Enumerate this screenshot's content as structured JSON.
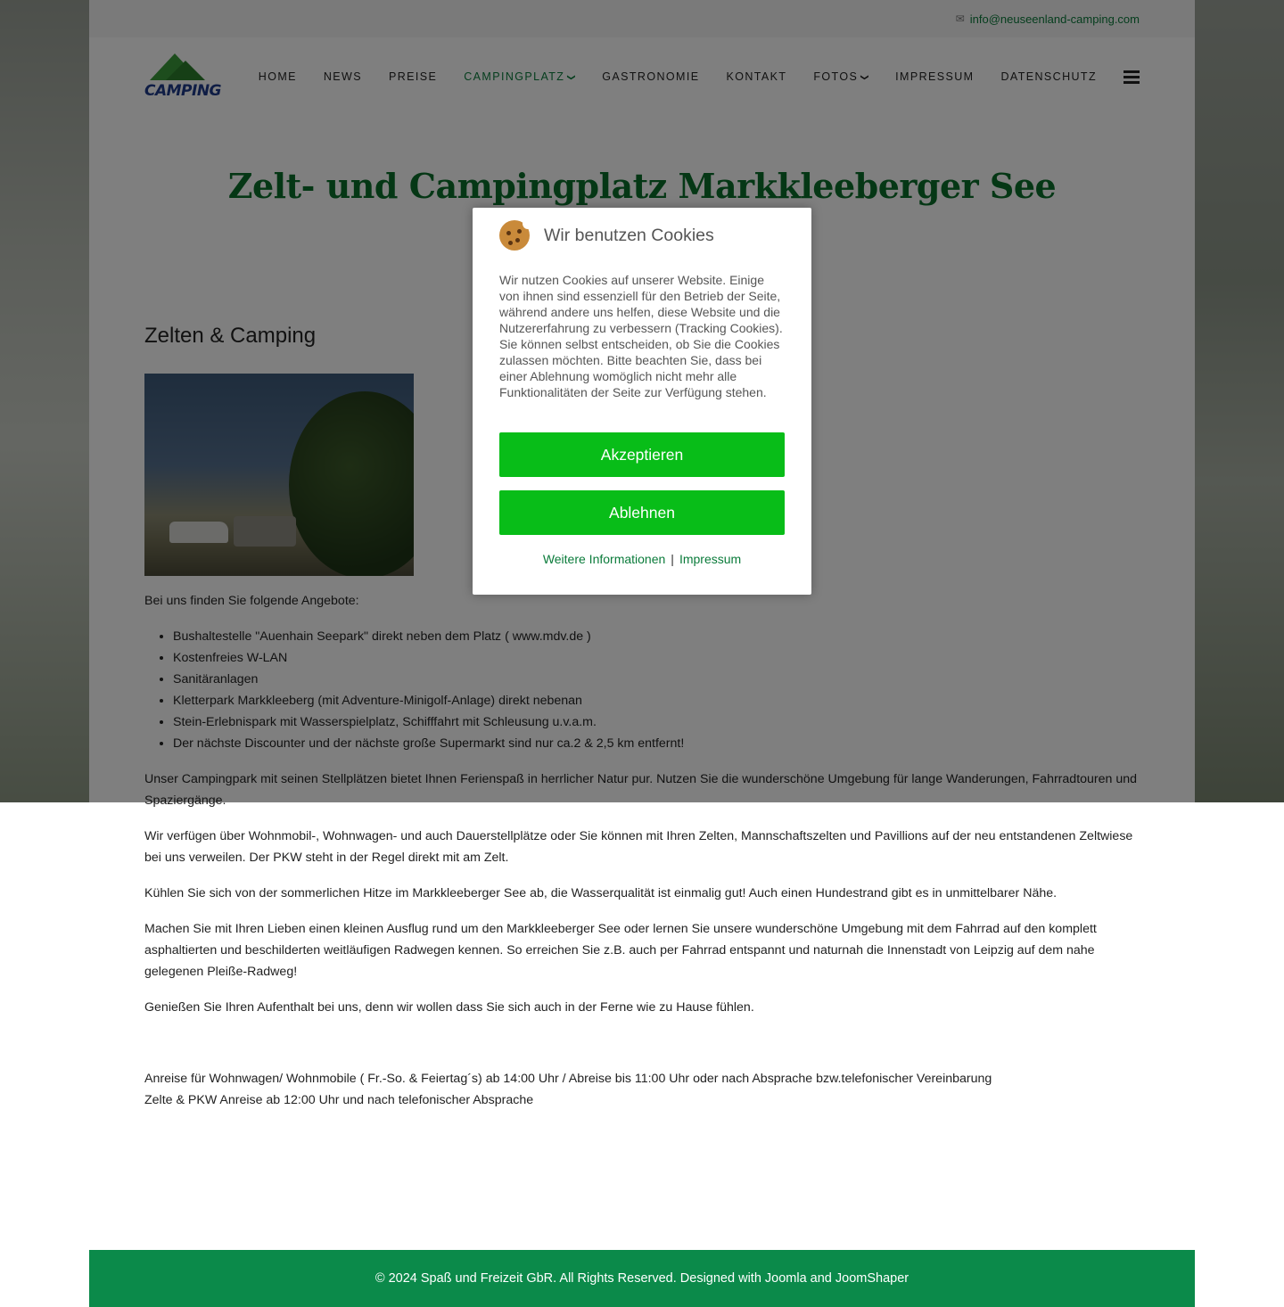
{
  "topbar": {
    "email": "info@neuseenland-camping.com",
    "email_icon": "envelope-icon"
  },
  "logo": {
    "word": "CAMPING"
  },
  "nav": {
    "items": [
      {
        "label": "HOME"
      },
      {
        "label": "NEWS"
      },
      {
        "label": "PREISE"
      },
      {
        "label": "CAMPINGPLATZ",
        "active": true,
        "has_dropdown": true
      },
      {
        "label": "GASTRONOMIE"
      },
      {
        "label": "KONTAKT"
      },
      {
        "label": "FOTOS",
        "has_dropdown": true
      },
      {
        "label": "IMPRESSUM"
      },
      {
        "label": "DATENSCHUTZ"
      }
    ],
    "caret": "❯"
  },
  "main": {
    "title": "Zelt- und Campingplatz Markkleeberger See",
    "section_heading": "Zelten & Camping",
    "intro": "Bei uns finden Sie folgende Angebote:",
    "offers": [
      "Bushaltestelle \"Auenhain Seepark\" direkt neben dem Platz ( www.mdv.de )",
      "Kostenfreies W-LAN",
      "Sanitäranlagen",
      "Kletterpark Markkleeberg (mit Adventure-Minigolf-Anlage) direkt nebenan",
      "Stein-Erlebnispark mit Wasserspielplatz, Schifffahrt mit Schleusung u.v.a.m.",
      "Der nächste Discounter und der nächste große Supermarkt sind nur ca.2 & 2,5 km entfernt!"
    ],
    "paragraphs": [
      "Unser Campingpark mit seinen Stellplätzen bietet Ihnen Ferienspaß in herrlicher Natur pur. Nutzen Sie die wunderschöne Umgebung für lange Wanderungen, Fahrradtouren und Spaziergänge.",
      "Wir verfügen über Wohnmobil-, Wohnwagen- und auch Dauerstellplätze oder Sie können mit Ihren Zelten, Mannschaftszelten und Pavillions auf der neu entstandenen Zeltwiese bei uns verweilen. Der PKW steht in der Regel direkt mit am Zelt.",
      "Kühlen Sie sich von der sommerlichen Hitze im Markkleeberger See ab, die Wasserqualität ist einmalig gut! Auch einen Hundestrand gibt es in unmittelbarer Nähe.",
      "Machen Sie mit Ihren Lieben einen kleinen Ausflug rund um den Markkleeberger See oder lernen Sie unsere wunderschöne Umgebung mit dem Fahrrad auf den komplett asphaltierten und beschilderten weitläufigen Radwegen kennen. So erreichen Sie z.B. auch per Fahrrad entspannt und naturnah die Innenstadt von Leipzig auf dem nahe gelegenen Pleiße-Radweg!",
      "Genießen Sie Ihren Aufenthalt bei uns, denn wir wollen dass Sie sich auch in der Ferne wie zu Hause fühlen."
    ],
    "arrival_line1": "Anreise für Wohnwagen/ Wohnmobile ( Fr.-So. & Feiertag´s) ab 14:00 Uhr / Abreise bis 11:00 Uhr oder nach Absprache bzw.telefonischer Vereinbarung",
    "arrival_line2": "Zelte & PKW Anreise ab 12:00 Uhr und nach telefonischer Absprache"
  },
  "footer": {
    "text": "© 2024 Spaß und Freizeit GbR. All Rights Reserved. Designed with Joomla and JoomShaper"
  },
  "cookie_modal": {
    "title": "Wir benutzen Cookies",
    "text": "Wir nutzen Cookies auf unserer Website. Einige von ihnen sind essenziell für den Betrieb der Seite, während andere uns helfen, diese Website und die Nutzererfahrung zu verbessern (Tracking Cookies). Sie können selbst entscheiden, ob Sie die Cookies zulassen möchten. Bitte beachten Sie, dass bei einer Ablehnung womöglich nicht mehr alle Funktionalitäten der Seite zur Verfügung stehen.",
    "accept_label": "Akzeptieren",
    "decline_label": "Ablehnen",
    "more_info_label": "Weitere Informationen",
    "separator": "|",
    "imprint_label": "Impressum",
    "button_color": "#08bd18"
  },
  "colors": {
    "accent_green": "#0a7b3a",
    "title_green": "#0b6e2b",
    "footer_green": "#0b8a4a"
  }
}
